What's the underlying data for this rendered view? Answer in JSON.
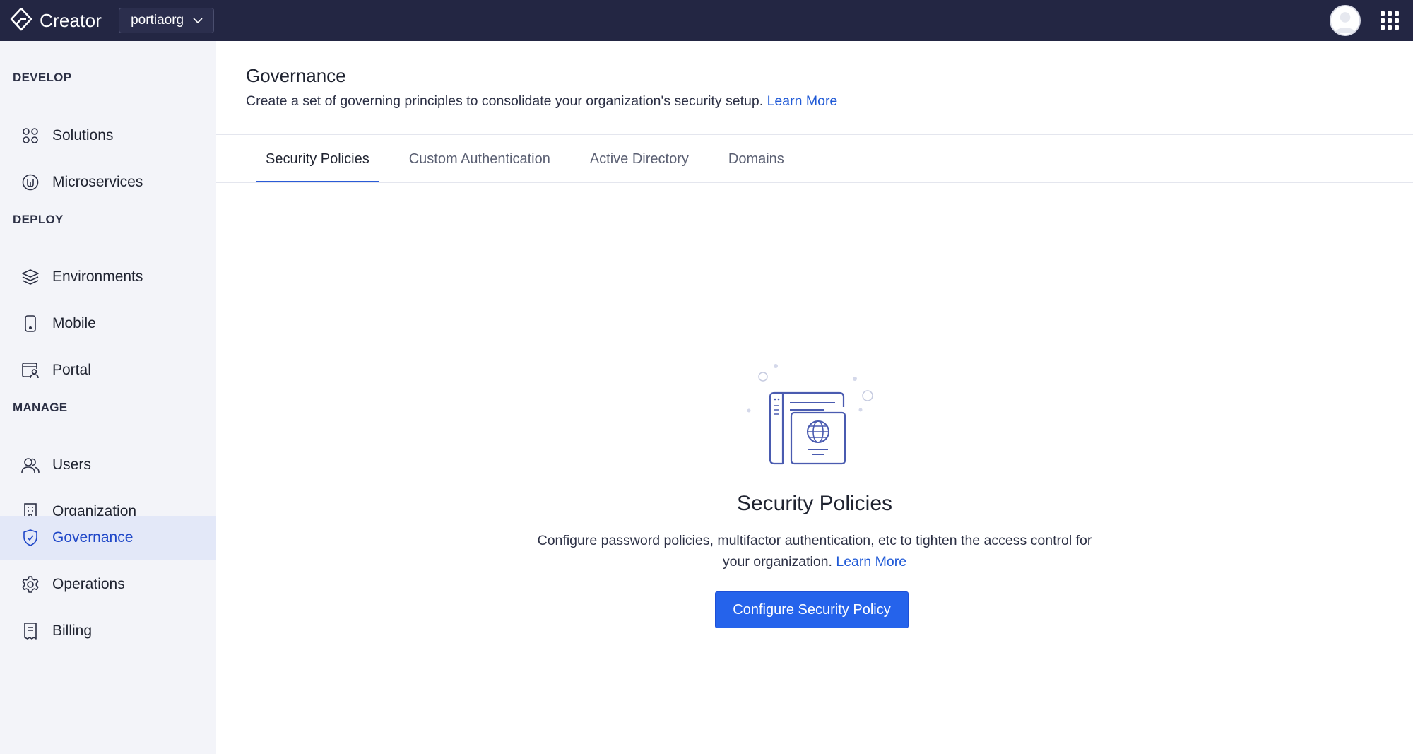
{
  "topbar": {
    "app_name": "Creator",
    "org_name": "portiaorg",
    "logo_icon": "creator-logo-icon",
    "avatar_icon": "user-avatar-icon",
    "apps_icon": "app-grid-icon"
  },
  "sidebar": {
    "sections": {
      "develop": "DEVELOP",
      "deploy": "DEPLOY",
      "manage": "MANAGE"
    },
    "items": [
      {
        "label": "Solutions",
        "icon": "solutions-icon"
      },
      {
        "label": "Microservices",
        "icon": "microservices-icon"
      },
      {
        "label": "Environments",
        "icon": "layers-icon"
      },
      {
        "label": "Mobile",
        "icon": "mobile-icon"
      },
      {
        "label": "Portal",
        "icon": "portal-icon"
      },
      {
        "label": "Users",
        "icon": "users-icon"
      },
      {
        "label": "Organization",
        "icon": "building-icon"
      },
      {
        "label": "Governance",
        "icon": "shield-check-icon",
        "active": true
      },
      {
        "label": "Operations",
        "icon": "gear-icon"
      },
      {
        "label": "Billing",
        "icon": "receipt-icon"
      }
    ]
  },
  "header": {
    "title": "Governance",
    "subtitle": "Create a set of governing principles to consolidate your organization's security setup.",
    "learn_more": "Learn More"
  },
  "tabs": [
    {
      "label": "Security Policies",
      "active": true
    },
    {
      "label": "Custom Authentication"
    },
    {
      "label": "Active Directory"
    },
    {
      "label": "Domains"
    }
  ],
  "empty_state": {
    "illustration": "security-policy-document-globe-icon",
    "title": "Security Policies",
    "description": "Configure password policies, multifactor authentication, etc to tighten the access control for your organization.",
    "learn_more": "Learn More",
    "button": "Configure Security Policy"
  },
  "colors": {
    "topbar_bg": "#232643",
    "sidebar_bg": "#f3f4f9",
    "active_item_bg": "#e3e8f8",
    "accent": "#2563eb",
    "link": "#1f59d6"
  }
}
